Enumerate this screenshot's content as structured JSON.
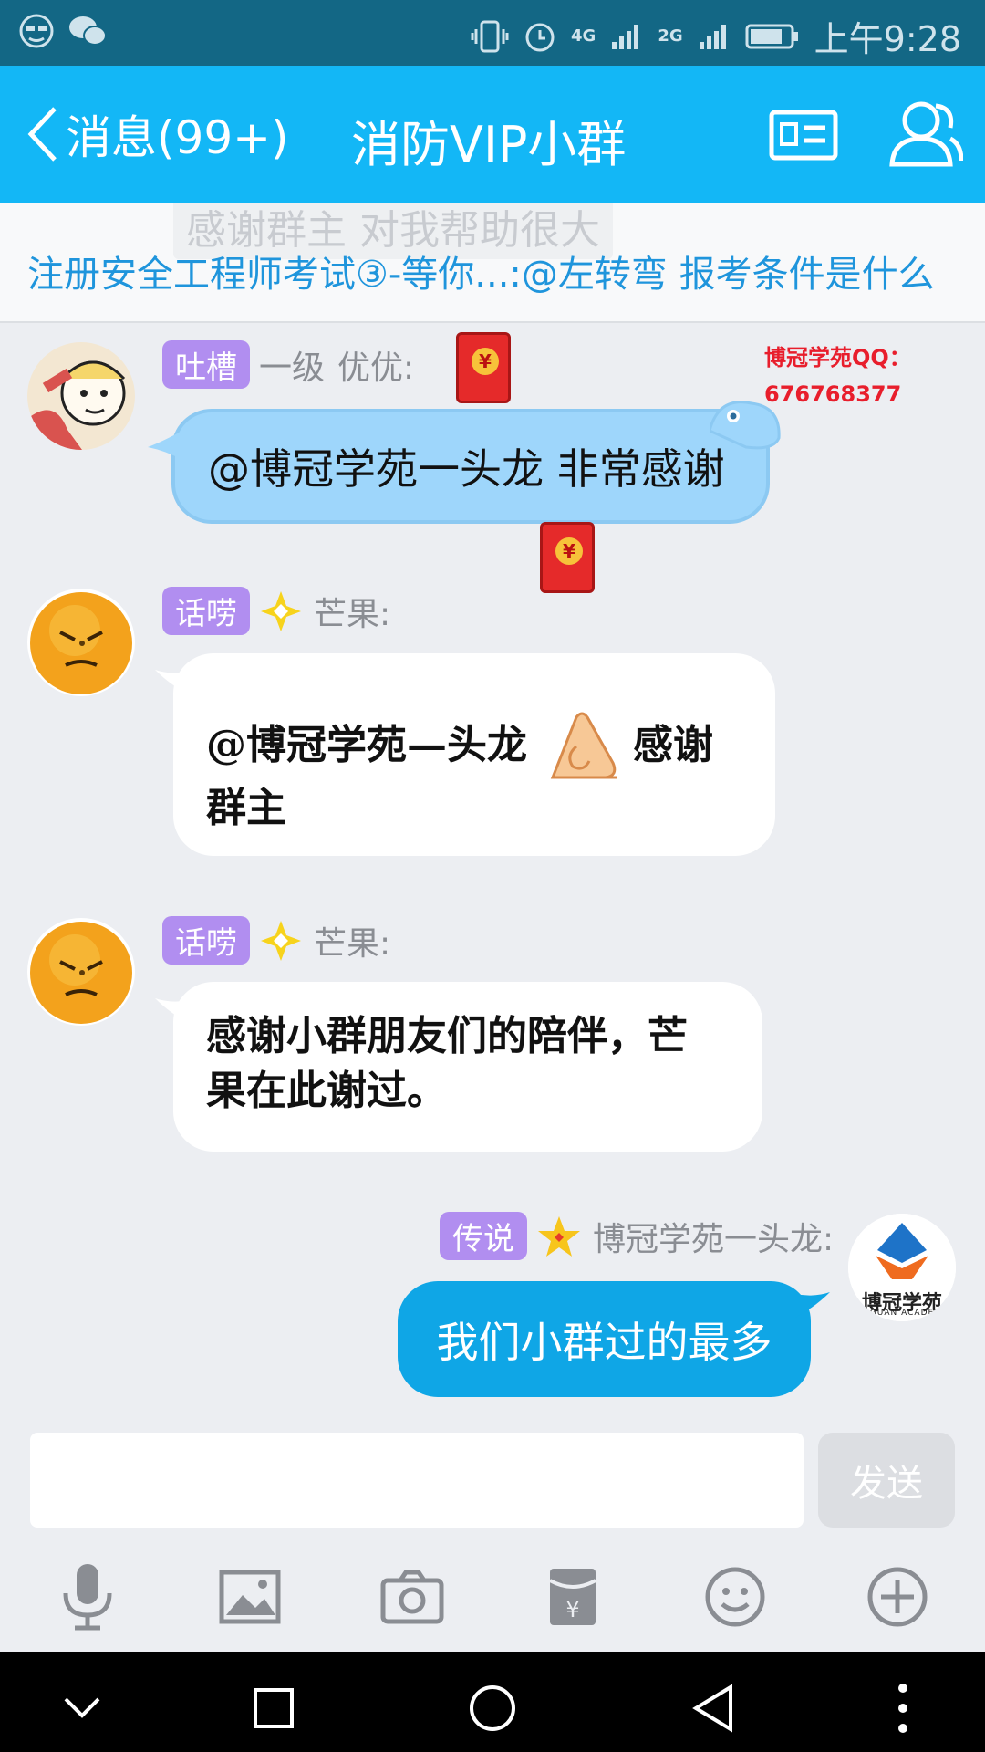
{
  "status_bar": {
    "network_1": "4G",
    "network_2": "2G",
    "time": "上午9:28"
  },
  "header": {
    "back_label": "消息(99+)",
    "title": "消防VIP小群"
  },
  "notice": {
    "ghost_text": "感谢群主 对我帮助很大",
    "text": "注册安全工程师考试③-等你...:@左转弯 报考条件是什么"
  },
  "messages": [
    {
      "badge": "吐槽",
      "rank": "一级",
      "sender": "优优:",
      "text": "@博冠学苑一头龙  非常感谢"
    },
    {
      "badge": "话唠",
      "sender": "芒果:",
      "text_line1_a": "@博冠学苑—头龙",
      "text_line1_b": "感谢",
      "text_line2": "群主"
    },
    {
      "badge": "话唠",
      "sender": "芒果:",
      "text_line1": "感谢小群朋友们的陪伴，芒",
      "text_line2": "果在此谢过。"
    },
    {
      "badge": "传说",
      "sender": "博冠学苑一头龙:",
      "text": "我们小群过的最多"
    }
  ],
  "watermark": {
    "line1": "博冠学苑QQ：",
    "line2": "676768377"
  },
  "logo": {
    "name": "博冠学苑",
    "sub": "GUAN ACADE"
  },
  "composer": {
    "placeholder": "",
    "send_label": "发送"
  },
  "toolbar": {
    "icons": [
      "microphone-icon",
      "image-icon",
      "camera-icon",
      "red-packet-icon",
      "emoji-icon",
      "plus-icon"
    ]
  },
  "colors": {
    "status_bar": "#136785",
    "title_bar": "#13b7f6",
    "notice_text": "#1f95dc",
    "badge": "#b18ef0",
    "own_bubble": "#0fa6e6",
    "watermark": "#e81e2c"
  }
}
